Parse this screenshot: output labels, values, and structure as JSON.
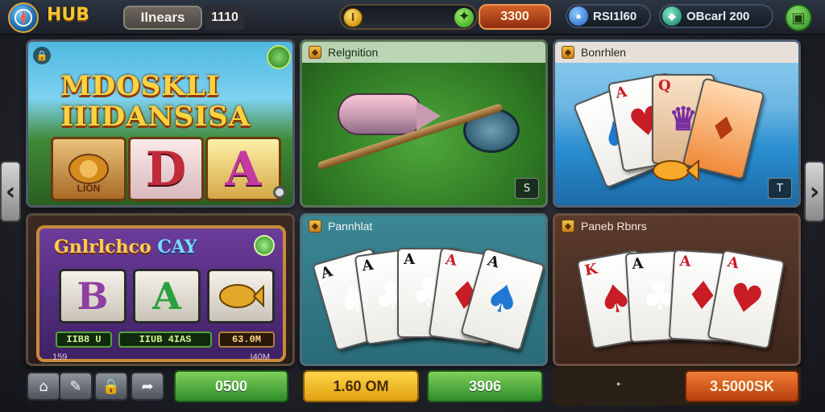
{
  "topbar": {
    "logo_text": "HUB",
    "player_name": "Ilnears",
    "player_level": "1110",
    "coins_value": "",
    "balance": "3300",
    "stat1_label": "RSI1l60",
    "stat2_label": "OBcarl 200"
  },
  "tiles": {
    "t1": {
      "title_line1": "MDOSKLI",
      "title_line2": "IIIDANSISA",
      "reel1_label": "LION",
      "reel2_symbol": "D",
      "reel3_symbol": "A"
    },
    "t2": {
      "header": "Relgnition",
      "corner": "S"
    },
    "t3": {
      "header": "Bonrhlen",
      "corner": "T"
    },
    "t4": {
      "title_a": "Gnlrlchco",
      "title_b": "CAY",
      "reel1": "B",
      "reel2": "A",
      "reel3": "",
      "led1": "IIB8 U",
      "led2": "IIUB 4IAS",
      "led3": "63.0M",
      "foot_left": "159",
      "foot_right": "I40M"
    },
    "t5": {
      "header": "Pannhlat"
    },
    "t6": {
      "header": "Paneb Rbnrs"
    }
  },
  "cards_t5": [
    {
      "idx": "A",
      "suit": "♠",
      "color": "black"
    },
    {
      "idx": "A",
      "suit": "♣",
      "color": "black"
    },
    {
      "idx": "A",
      "suit": "♣",
      "color": "black"
    },
    {
      "idx": "A",
      "suit": "♦",
      "color": "red"
    },
    {
      "idx": "A",
      "suit": "♠",
      "color": "blue"
    }
  ],
  "cards_t6": [
    {
      "idx": "K",
      "suit": "♠",
      "color": "red"
    },
    {
      "idx": "A",
      "suit": "♣",
      "color": "black"
    },
    {
      "idx": "A",
      "suit": "♦",
      "color": "red"
    },
    {
      "idx": "A",
      "suit": "♥",
      "color": "red"
    }
  ],
  "bottom": {
    "play_button_1": "0500",
    "price_yellow": "1.60 OM",
    "price_green": "3906",
    "price_orange": "3.5000SK",
    "dot_label": "•"
  },
  "colors": {
    "accent_gold": "#f7c531",
    "button_green": "#2e8d2a",
    "button_orange": "#b63e0d"
  }
}
